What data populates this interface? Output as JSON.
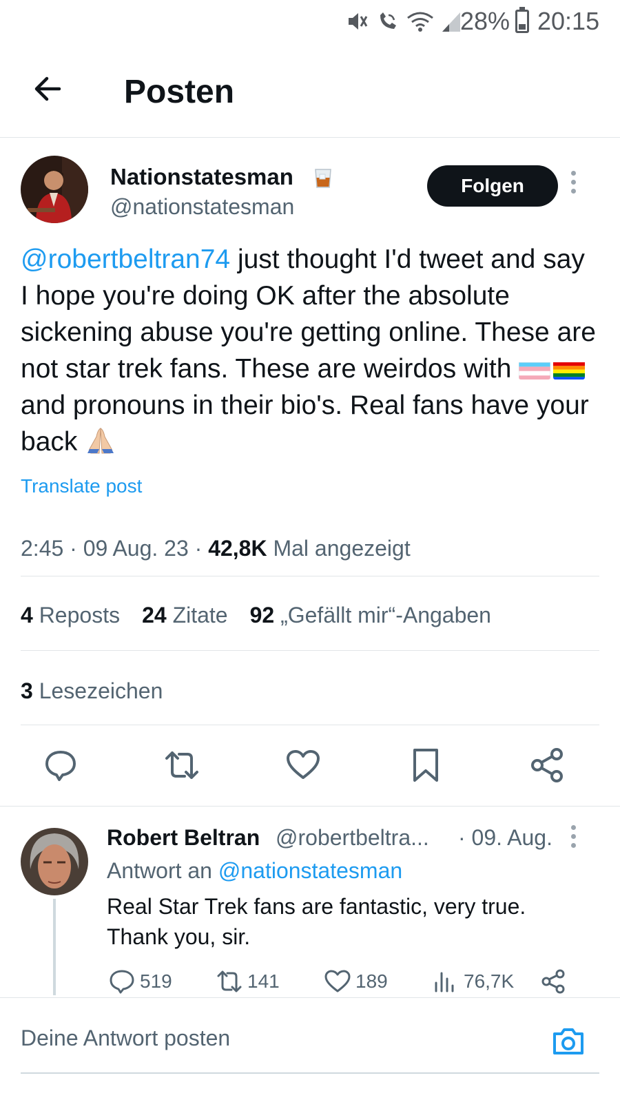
{
  "status_bar": {
    "battery_percent": "28%",
    "time": "20:15",
    "icons": [
      "mute-vibrate-icon",
      "wifi-calling-icon",
      "wifi-icon",
      "cell-signal-icon",
      "battery-icon"
    ]
  },
  "header": {
    "title": "Posten",
    "back_icon": "arrow-left-icon"
  },
  "post": {
    "author_name": "Nationstatesman",
    "author_emoji": "whisky-glass-icon",
    "author_handle": "@nationstatesman",
    "follow_label": "Folgen",
    "text": {
      "mention": "@robertbeltran74",
      "part1": " just thought I'd tweet and say I hope you're doing OK after the absolute sickening abuse you're getting online. These are not star trek fans. These are weirdos with ",
      "emoji_flags": [
        "transgender-flag-icon",
        "rainbow-flag-icon"
      ],
      "part2": " and pronouns in their bio's. Real fans have your back ",
      "emoji_end": "folded-hands-icon"
    },
    "translate_label": "Translate post",
    "meta": {
      "time": "2:45",
      "date": "09 Aug. 23",
      "views": "42,8K",
      "views_label": "Mal angezeigt"
    },
    "stats": {
      "reposts_count": "4",
      "reposts_label": "Reposts",
      "quotes_count": "24",
      "quotes_label": "Zitate",
      "likes_count": "92",
      "likes_label": "„Gefällt mir“-Angaben",
      "bookmarks_count": "3",
      "bookmarks_label": "Lesezeichen"
    },
    "actions": [
      "reply-icon",
      "repost-icon",
      "like-icon",
      "bookmark-icon",
      "share-icon"
    ]
  },
  "reply": {
    "author_name": "Robert Beltran",
    "author_handle": "@robertbeltra...",
    "date": "· 09. Aug.",
    "reply_to_prefix": "Antwort an",
    "reply_to_handle": "@nationstatesman",
    "text_line1": "Real Star Trek fans are fantastic, very true.",
    "text_line2": "Thank you, sir.",
    "counts": {
      "replies": "519",
      "reposts": "141",
      "likes": "189",
      "views": "76,7K"
    }
  },
  "composer": {
    "placeholder": "Deine Antwort posten",
    "camera_icon": "camera-icon"
  },
  "colors": {
    "accent": "#1d9bf0",
    "text": "#0f1419",
    "secondary": "#536471",
    "divider": "#e1e5e8"
  }
}
